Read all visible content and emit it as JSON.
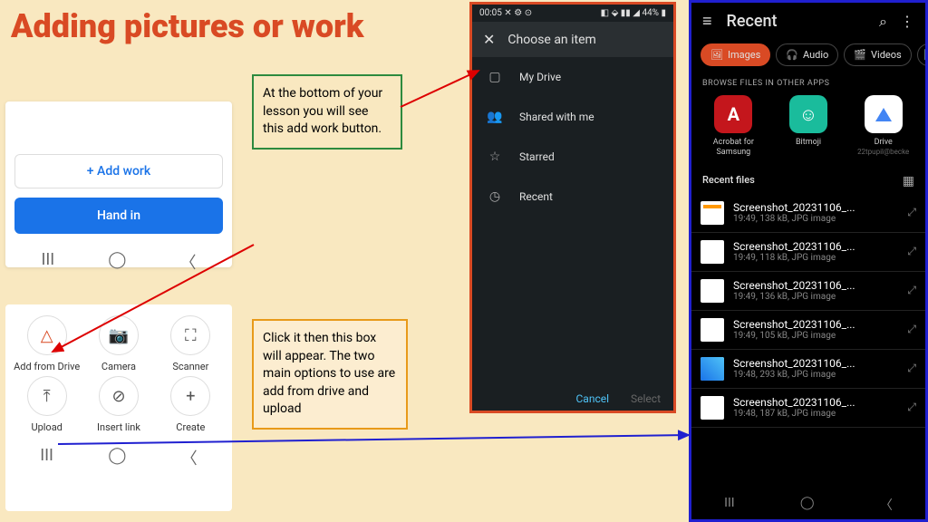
{
  "title": "Adding pictures or work",
  "callout1": "At the bottom of your lesson you will see this add work button.",
  "callout2": "Click it then this box will appear. The two main options to use are add from drive and upload",
  "ss1": {
    "add_work": "+  Add work",
    "hand_in": "Hand in"
  },
  "ss2": {
    "options": [
      {
        "label": "Add from Drive",
        "glyph": "△"
      },
      {
        "label": "Camera",
        "glyph": "📷"
      },
      {
        "label": "Scanner",
        "glyph": "⛶"
      },
      {
        "label": "Upload",
        "glyph": "⤒"
      },
      {
        "label": "Insert link",
        "glyph": "⊘"
      },
      {
        "label": "Create",
        "glyph": "+"
      }
    ]
  },
  "ss3": {
    "time": "00:05",
    "battery": "44%",
    "header": "Choose an item",
    "items": [
      {
        "label": "My Drive",
        "glyph": "▢"
      },
      {
        "label": "Shared with me",
        "glyph": "👥"
      },
      {
        "label": "Starred",
        "glyph": "☆"
      },
      {
        "label": "Recent",
        "glyph": "◷"
      }
    ],
    "cancel": "Cancel",
    "select": "Select"
  },
  "ss4": {
    "title": "Recent",
    "chips": [
      {
        "label": "Images",
        "glyph": "🖼"
      },
      {
        "label": "Audio",
        "glyph": "🎧"
      },
      {
        "label": "Videos",
        "glyph": "🎬"
      }
    ],
    "browse_label": "BROWSE FILES IN OTHER APPS",
    "apps": [
      {
        "name": "Acrobat for Samsung",
        "sub": "",
        "glyph": "A"
      },
      {
        "name": "Bitmoji",
        "sub": "",
        "glyph": "☺"
      },
      {
        "name": "Drive",
        "sub": "22tpupil@becke",
        "glyph": ""
      }
    ],
    "recent_files_label": "Recent files",
    "files": [
      {
        "name": "Screenshot_20231106_...",
        "meta": "19:49, 138 kB, JPG image"
      },
      {
        "name": "Screenshot_20231106_...",
        "meta": "19:49, 118 kB, JPG image"
      },
      {
        "name": "Screenshot_20231106_...",
        "meta": "19:49, 136 kB, JPG image"
      },
      {
        "name": "Screenshot_20231106_...",
        "meta": "19:49, 105 kB, JPG image"
      },
      {
        "name": "Screenshot_20231106_...",
        "meta": "19:48, 293 kB, JPG image"
      },
      {
        "name": "Screenshot_20231106_...",
        "meta": "19:48, 187 kB, JPG image"
      }
    ]
  }
}
